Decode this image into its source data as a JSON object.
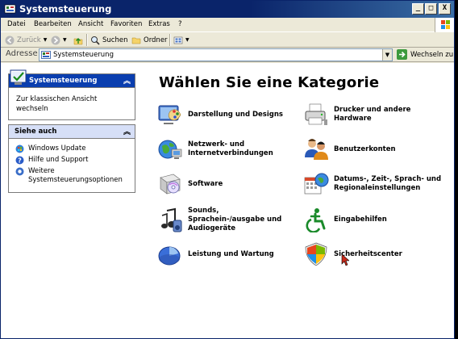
{
  "window": {
    "title": "Systemsteuerung",
    "controls": [
      "_",
      "□",
      "X"
    ]
  },
  "menubar": {
    "items": [
      "Datei",
      "Bearbeiten",
      "Ansicht",
      "Favoriten",
      "Extras",
      "?"
    ]
  },
  "toolbar": {
    "back_label": "Zurück",
    "search_label": "Suchen",
    "folders_label": "Ordner"
  },
  "addressbar": {
    "label": "Adresse",
    "value": "Systemsteuerung",
    "go_label": "Wechseln zu"
  },
  "sidebar": {
    "main_panel": {
      "title": "Systemsteuerung",
      "link": "Zur klassischen Ansicht wechseln"
    },
    "see_also": {
      "title": "Siehe auch",
      "items": [
        "Windows Update",
        "Hilfe und Support",
        "Weitere Systemsteuerungsoptionen"
      ]
    }
  },
  "main": {
    "heading": "Wählen Sie eine Kategorie",
    "categories": [
      {
        "label": "Darstellung und Designs",
        "icon": "appearance-icon"
      },
      {
        "label": "Drucker und andere Hardware",
        "icon": "printer-icon"
      },
      {
        "label": "Netzwerk- und Internetverbindungen",
        "icon": "network-icon"
      },
      {
        "label": "Benutzerkonten",
        "icon": "users-icon"
      },
      {
        "label": "Software",
        "icon": "software-icon"
      },
      {
        "label": "Datums-, Zeit-, Sprach- und Regionaleinstellungen",
        "icon": "datetime-icon"
      },
      {
        "label": "Sounds, Sprachein-/ausgabe und Audiogeräte",
        "icon": "sound-icon"
      },
      {
        "label": "Eingabehilfen",
        "icon": "accessibility-icon"
      },
      {
        "label": "Leistung und Wartung",
        "icon": "performance-icon"
      },
      {
        "label": "Sicherheitscenter",
        "icon": "security-shield-icon"
      }
    ]
  },
  "colors": {
    "titlebar": "#0A246A",
    "panel_header_active": "#0A3EAF",
    "panel_header": "#D6DFF7",
    "window_bg": "#ECE9D8"
  }
}
